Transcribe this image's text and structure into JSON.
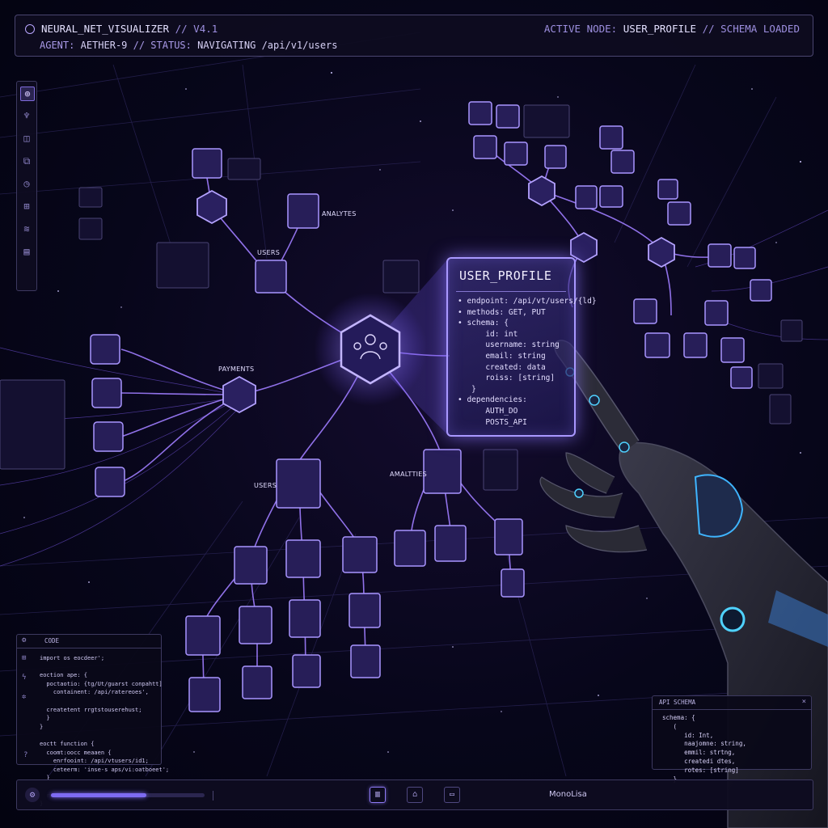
{
  "header": {
    "app_name": "NEURAL_NET_VISUALIZER",
    "version_sep": "//",
    "version": "V4.1",
    "agent_label": "AGENT:",
    "agent_value": "AETHER-9",
    "status_label": "// STATUS:",
    "status_value": "NAVIGATING /api/v1/users",
    "active_label": "ACTIVE NODE:",
    "active_value": "USER_PROFILE",
    "schema_state": "// SCHEMA LOADED"
  },
  "toolbar": {
    "icons": [
      "globe-icon",
      "tree-icon",
      "cube-icon",
      "link-icon",
      "clock-icon",
      "grid-icon",
      "layers-icon",
      "document-icon"
    ]
  },
  "profile_card": {
    "title": "USER_PROFILE",
    "lines": [
      "• endpoint: /api/vt/users/{ld}",
      "• methods: GET, PUT",
      "• schema: {",
      "      id: int",
      "      username: string",
      "      email: string",
      "      created: data",
      "      roiss: [string]",
      "   }",
      "• dependencies:",
      "      AUTH_DO",
      "      POSTS_API"
    ]
  },
  "scene_labels": {
    "analytes": "ANALYTES",
    "users_top": "USERS",
    "payments": "PAYMENTS",
    "users_mid": "USERS",
    "analytics_mid": "AMALTTIES"
  },
  "code_panel": {
    "title": "CODE",
    "lines": [
      "import os eocdeer';",
      "",
      "eoction ape: {",
      "  poctaotio: {tg/Ut/guarst conpahtt]",
      "    containent: /api/ratereoes',",
      "",
      "  createtent rrgtstouserehust;",
      "  }",
      "}",
      "",
      "eoctt function {",
      "  coomt:oocc meaaen {",
      "    enrfooint: /api/vtusers/id1;",
      "    ceteerm: 'inse-s aps/vi:oatboeet';",
      "  }",
      "",
      "  return default.",
      "}"
    ]
  },
  "schema_panel": {
    "title": "API SCHEMA",
    "close": "×",
    "lines": [
      "schema: {",
      "   (",
      "      id: Int,",
      "      naajomne: string,",
      "      emmil: strtng,",
      "      createdi dtes,",
      "      rotes: [string]",
      "   }"
    ]
  },
  "bottom_bar": {
    "progress": 0.62,
    "font_label": "MonoLisa"
  },
  "colors": {
    "accent": "#8d79f5",
    "node_glow": "#a998ff",
    "background": "#07061a"
  }
}
